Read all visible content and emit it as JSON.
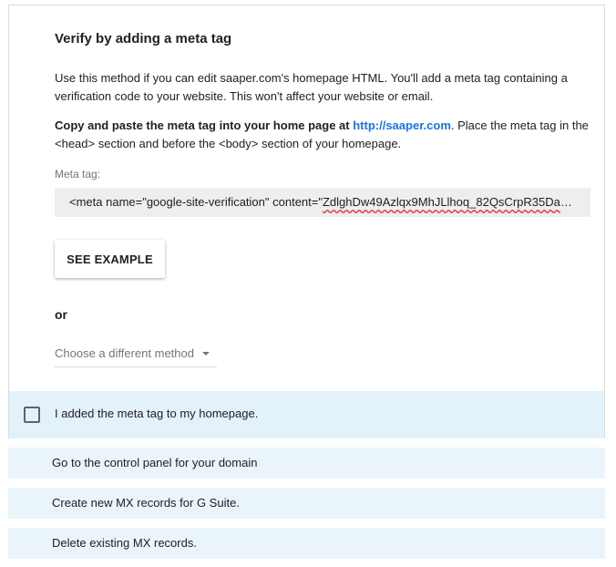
{
  "section": {
    "title": "Verify by adding a meta tag",
    "intro": "Use this method if you can edit saaper.com's homepage HTML. You'll add a meta tag containing a verification code to your website. This won't affect your website or email.",
    "instruction_bold": "Copy and paste the meta tag into your home page at",
    "instruction_link": "http://saaper.com",
    "instruction_rest": ". Place the meta tag in the <head> section and before the <body> section of your homepage.",
    "meta_label": "Meta tag:",
    "meta_prefix": "<meta name=\"google-site-verification\" content=\"",
    "meta_code": "ZdlghDw49Azlqx9MhJLlhoq_82QsCrpR35Da1…",
    "see_example_label": "SEE EXAMPLE",
    "or_label": "or",
    "method_select": "Choose a different method",
    "confirm_label": "I added the meta tag to my homepage."
  },
  "steps": [
    {
      "label": "Go to the control panel for your domain"
    },
    {
      "label": "Create new MX records for G Suite."
    },
    {
      "label": "Delete existing MX records."
    }
  ],
  "colors": {
    "link": "#1a73e8",
    "confirm_bg": "#e3f1fb",
    "step_bg": "#eaf4fb",
    "code_box_bg": "#eeeeee"
  }
}
